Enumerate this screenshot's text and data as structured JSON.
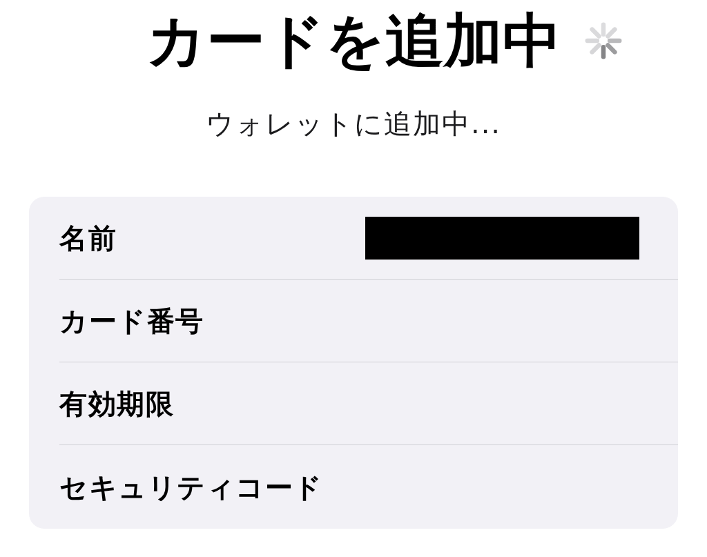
{
  "title": "カードを追加中",
  "loading": true,
  "subtitle": "ウォレットに追加中...",
  "fields": [
    {
      "label": "名前",
      "redacted": true
    },
    {
      "label": "カード番号",
      "redacted": false
    },
    {
      "label": "有効期限",
      "redacted": false
    },
    {
      "label": "セキュリティコード",
      "redacted": false
    }
  ]
}
